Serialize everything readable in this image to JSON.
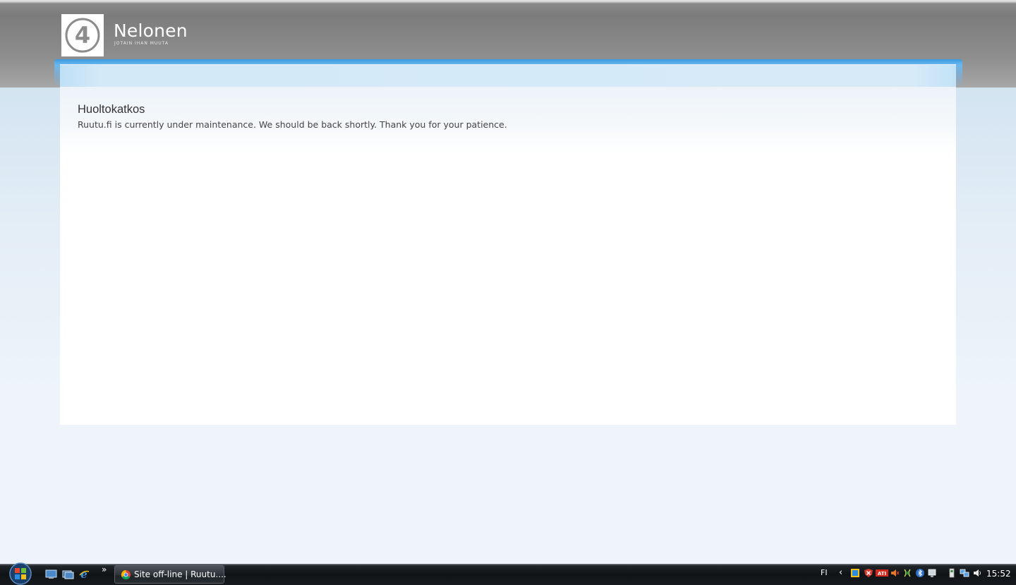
{
  "header": {
    "logo_glyph": "4",
    "brand_name": "Nelonen",
    "brand_tagline": "JOTAIN IHAN MUUTA"
  },
  "main": {
    "title": "Huoltokatkos",
    "message": "Ruutu.fi is currently under maintenance. We should be back shortly. Thank you for your patience."
  },
  "taskbar": {
    "start_icon": "windows-orb-icon",
    "quicklaunch": [
      "show-desktop-icon",
      "switch-windows-icon",
      "internet-explorer-icon"
    ],
    "quicklaunch_more": "»",
    "active_task_label": "Site off-line | Ruutu....",
    "active_task_icon": "chrome-icon",
    "language": "FI",
    "tray_expand": "‹",
    "tray_icons": [
      "windows-update-icon",
      "security-alert-icon",
      "ati-icon",
      "speaker-muted-icon",
      "network-icon",
      "bluetooth-icon",
      "display-icon",
      "usb-device-icon",
      "network-connection-icon",
      "volume-icon"
    ],
    "clock": "15:52"
  },
  "colors": {
    "accent_blue": "#3a9be3",
    "header_gray": "#7c7c7c",
    "page_bg": "#eef4fa"
  }
}
